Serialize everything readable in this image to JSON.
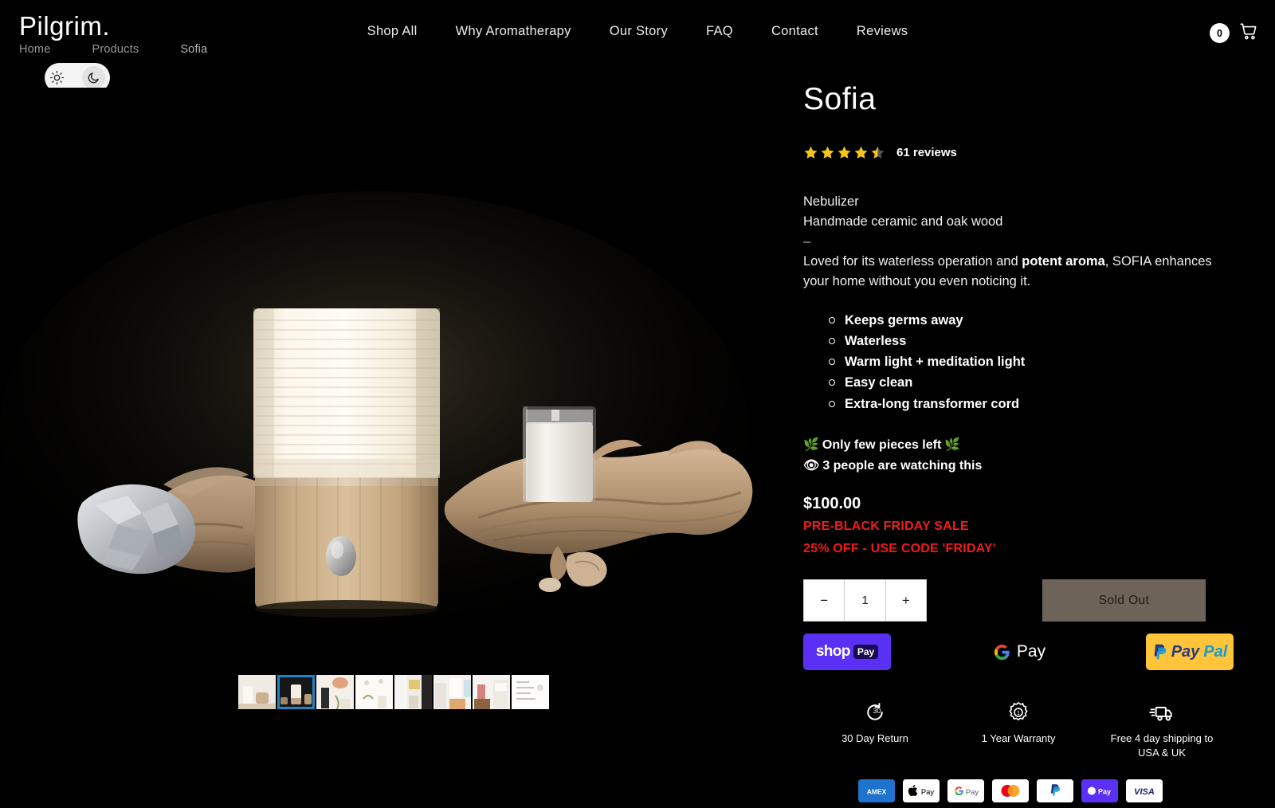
{
  "header": {
    "logo": "Pilgrim.",
    "breadcrumb": [
      "Home",
      "Products",
      "Sofia"
    ],
    "nav": [
      "Shop All",
      "Why Aromatherapy",
      "Our Story",
      "FAQ",
      "Contact",
      "Reviews"
    ],
    "cart_count": "0",
    "theme_toggle": {
      "light_icon": "sun-icon",
      "dark_icon": "moon-icon",
      "active": "dark"
    }
  },
  "gallery": {
    "selected_index": 1,
    "thumbnails": [
      {
        "alt": "Sofia diffuser on table, light scene"
      },
      {
        "alt": "Sofia diffuser glowing, dark scene"
      },
      {
        "alt": "Sofia diffuser with dried flowers"
      },
      {
        "alt": "Sofia diffuser on white shelf"
      },
      {
        "alt": "Sofia diffuser in bedroom"
      },
      {
        "alt": "Sofia diffuser in living room"
      },
      {
        "alt": "Sofia diffuser on dresser"
      },
      {
        "alt": "Product specification chart"
      }
    ]
  },
  "product": {
    "title": "Sofia",
    "rating_value": 4.5,
    "reviews_label": "61 reviews",
    "description": {
      "line1": "Nebulizer",
      "line2": "Handmade ceramic and oak wood",
      "divider": "–",
      "body_before": "Loved for its waterless operation and ",
      "body_bold": "potent aroma",
      "body_after": ", SOFIA enhances your home without you even noticing it."
    },
    "features": [
      "Keeps germs away",
      "Waterless",
      "Warm light + meditation light",
      "Easy clean",
      "Extra-long transformer cord"
    ],
    "urgency": {
      "stock_icon_left": "🌿",
      "stock_text": "Only few pieces left",
      "stock_icon_right": "🌿",
      "watchers_icon": "👁",
      "watchers_text": "3 people are watching this"
    },
    "price": "$100.00",
    "sale_line1": "PRE-BLACK FRIDAY SALE",
    "sale_line2": "25% OFF - USE CODE 'FRIDAY'",
    "quantity": {
      "decrement": "−",
      "value": "1",
      "increment": "+"
    },
    "add_to_cart_label": "Sold Out"
  },
  "express_checkout": {
    "shop_pay": {
      "word": "shop",
      "pill": "Pay"
    },
    "google_pay": {
      "label": "Pay"
    },
    "paypal": {
      "part1": "Pay",
      "part2": "Pal"
    }
  },
  "trust_badges": [
    {
      "icon": "return-30-icon",
      "label": "30 Day Return"
    },
    {
      "icon": "warranty-badge-icon",
      "label": "1 Year Warranty"
    },
    {
      "icon": "delivery-truck-icon",
      "label": "Free 4 day shipping to USA & UK"
    }
  ],
  "payment_methods": [
    {
      "name": "AMEX",
      "label": "AMEX"
    },
    {
      "name": "Apple Pay",
      "label": "Pay"
    },
    {
      "name": "Google Pay",
      "label": "Pay"
    },
    {
      "name": "Mastercard",
      "label": ""
    },
    {
      "name": "PayPal",
      "label": ""
    },
    {
      "name": "Shop Pay",
      "label": "Pay"
    },
    {
      "name": "VISA",
      "label": "VISA"
    }
  ],
  "colors": {
    "background": "#000000",
    "accent_sale": "#f21b1b",
    "star": "#f5c518",
    "sold_out": "#6e6358",
    "shop_pay": "#5a31f4",
    "paypal": "#ffc439",
    "thumb_selected": "#1d86c4"
  }
}
